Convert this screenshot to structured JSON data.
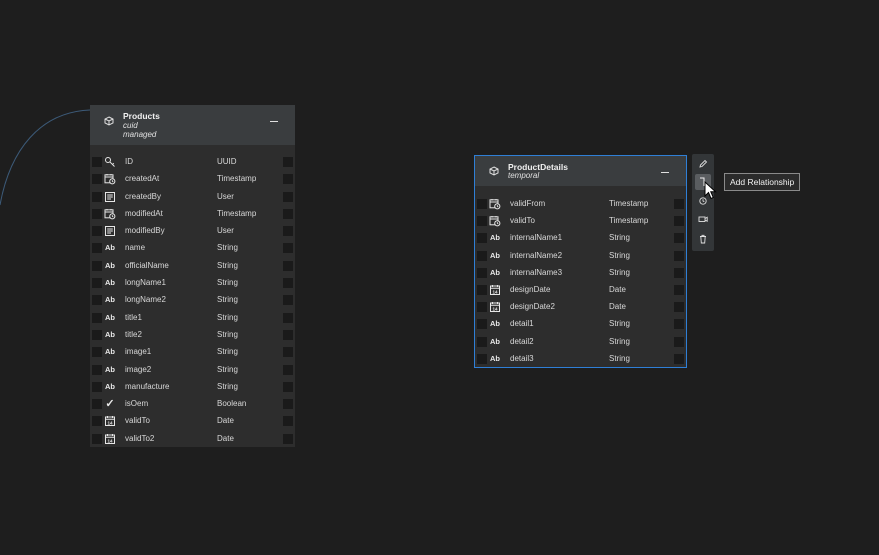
{
  "products": {
    "title": "Products",
    "subtitle_1": "cuid",
    "subtitle_2": "managed",
    "fields": [
      {
        "icon": "key-icon",
        "name": "ID",
        "type": "UUID"
      },
      {
        "icon": "calendar-clock-icon",
        "name": "createdAt",
        "type": "Timestamp"
      },
      {
        "icon": "user-card-icon",
        "name": "createdBy",
        "type": "User"
      },
      {
        "icon": "calendar-clock-icon",
        "name": "modifiedAt",
        "type": "Timestamp"
      },
      {
        "icon": "user-card-icon",
        "name": "modifiedBy",
        "type": "User"
      },
      {
        "icon": "text-icon",
        "name": "name",
        "type": "String"
      },
      {
        "icon": "text-icon",
        "name": "officialName",
        "type": "String"
      },
      {
        "icon": "text-icon",
        "name": "longName1",
        "type": "String"
      },
      {
        "icon": "text-icon",
        "name": "longName2",
        "type": "String"
      },
      {
        "icon": "text-icon",
        "name": "title1",
        "type": "String"
      },
      {
        "icon": "text-icon",
        "name": "title2",
        "type": "String"
      },
      {
        "icon": "text-icon",
        "name": "image1",
        "type": "String"
      },
      {
        "icon": "text-icon",
        "name": "image2",
        "type": "String"
      },
      {
        "icon": "text-icon",
        "name": "manufacture",
        "type": "String"
      },
      {
        "icon": "checkmark-icon",
        "name": "isOem",
        "type": "Boolean"
      },
      {
        "icon": "calendar-icon",
        "name": "validTo",
        "type": "Date"
      },
      {
        "icon": "calendar-icon",
        "name": "validTo2",
        "type": "Date"
      }
    ]
  },
  "details": {
    "title": "ProductDetails",
    "subtitle_1": "temporal",
    "fields": [
      {
        "icon": "calendar-clock-icon",
        "name": "validFrom",
        "type": "Timestamp"
      },
      {
        "icon": "calendar-clock-icon",
        "name": "validTo",
        "type": "Timestamp"
      },
      {
        "icon": "text-icon",
        "name": "internalName1",
        "type": "String"
      },
      {
        "icon": "text-icon",
        "name": "internalName2",
        "type": "String"
      },
      {
        "icon": "text-icon",
        "name": "internalName3",
        "type": "String"
      },
      {
        "icon": "calendar-icon",
        "name": "designDate",
        "type": "Date"
      },
      {
        "icon": "calendar-icon",
        "name": "designDate2",
        "type": "Date"
      },
      {
        "icon": "text-icon",
        "name": "detail1",
        "type": "String"
      },
      {
        "icon": "text-icon",
        "name": "detail2",
        "type": "String"
      },
      {
        "icon": "text-icon",
        "name": "detail3",
        "type": "String"
      }
    ]
  },
  "toolbar": {
    "tools": [
      "pencil-icon",
      "add-relationship-icon",
      "temporal-icon",
      "camera-icon",
      "trash-icon"
    ],
    "tooltip": "Add Relationship"
  },
  "icons": {
    "text_glyph": "Ab",
    "check_glyph": "✓"
  },
  "colors": {
    "background": "#1e1e1e",
    "selection_border": "#2f7fd6",
    "handle_accent": "#1676d2"
  }
}
